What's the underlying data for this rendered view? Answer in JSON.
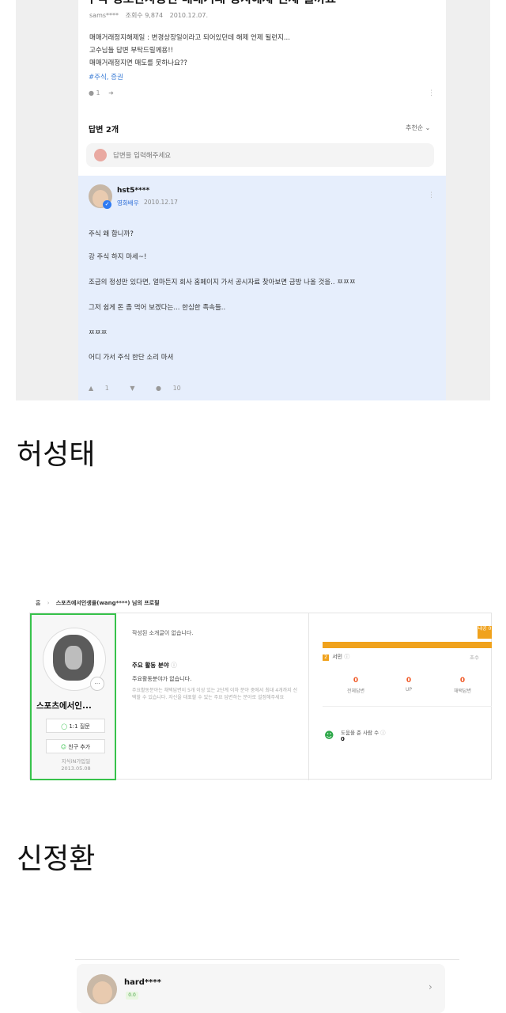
{
  "question": {
    "title": "주식 정보관사농진 매매거래 정지해제 언제 될까요",
    "author": "sams****",
    "views": "조회수 9,874",
    "date": "2010.12.07.",
    "body": [
      "매매거래정지해제일 : 변경상장일이라고 되어있던데 해제 언제 될런지...",
      "고수님들 답변 부탁드릴께용!!",
      "매매거래정지면 매도를 못하나요??"
    ],
    "tags": "#주식, 증권",
    "comment_count": "1",
    "answers_header": "답변 2개",
    "sort_label": "추천순",
    "answer_placeholder": "답변을 입력해주세요"
  },
  "answer": {
    "author": "hst5****",
    "role": "영화배우",
    "date": "2010.12.17",
    "lines": [
      "주식 왜 합니까?",
      "강 주식 하지 마세~!",
      "조금의 정성만 있다면, 얼마든지 회사 홈페이지 가서 공시자료 찾아보면 금방 나올 것을.. ㅉㅉㅉ",
      "그저 쉽게 돈 좀 먹어 보겠다는... 한심한 족속들..",
      "ㅉㅉㅉ",
      "어디 가서 주식 한단 소리 마셔"
    ],
    "likes": "1",
    "comments": "10"
  },
  "name1": "허성태",
  "name2": "신정환",
  "profile": {
    "breadcrumb_home": "홈",
    "breadcrumb_title": "스포츠에서인생을(wang****) 님의 프로필",
    "name": "스포츠에서인...",
    "question_button": "1:1 질문",
    "friend_button": "친구 추가",
    "joined_label": "지식iN가입일",
    "joined_date": "2013.05.08",
    "intro": "작성된 소개글이 없습니다.",
    "area_title": "주요 활동 분야",
    "area_value": "주요활동분야가 없습니다.",
    "area_desc": "주요활동분야는 채택답변이 5개 이상 있는 2단계 이하 분야 중에서 최대 4개까지 선택할 수 있습니다. 자신을 대표할 수 있는 주요 답변하는 분야로 설정해주세요",
    "level_badge": "내공 0",
    "rank_label": "서민",
    "next_rank": "초수",
    "stats": [
      {
        "value": "0",
        "label": "전체답변"
      },
      {
        "value": "0",
        "label": "UP"
      },
      {
        "value": "0",
        "label": "채택답변"
      }
    ],
    "helped_label": "도움을 준 사람 수",
    "helped_value": "0"
  },
  "user_row": {
    "name": "hard****",
    "badge": "0.0"
  },
  "colors": {
    "accent_blue": "#2f7bf3",
    "level_orange": "#f0a21c",
    "stat_red": "#f05a28",
    "profile_green": "#37c24b"
  }
}
